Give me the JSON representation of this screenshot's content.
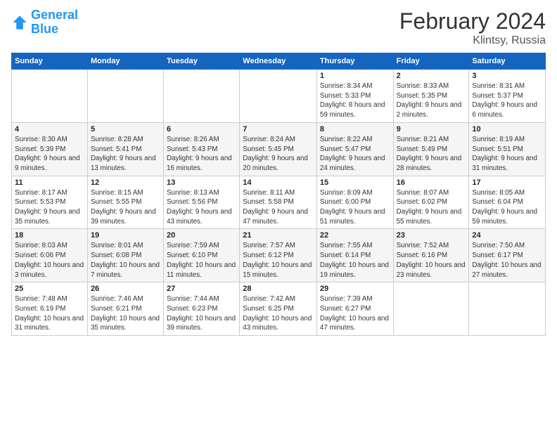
{
  "logo": {
    "line1": "General",
    "line2": "Blue"
  },
  "title": "February 2024",
  "subtitle": "Klintsy, Russia",
  "days_header": [
    "Sunday",
    "Monday",
    "Tuesday",
    "Wednesday",
    "Thursday",
    "Friday",
    "Saturday"
  ],
  "weeks": [
    [
      {
        "day": "",
        "info": ""
      },
      {
        "day": "",
        "info": ""
      },
      {
        "day": "",
        "info": ""
      },
      {
        "day": "",
        "info": ""
      },
      {
        "day": "1",
        "info": "Sunrise: 8:34 AM\nSunset: 5:33 PM\nDaylight: 8 hours and 59 minutes."
      },
      {
        "day": "2",
        "info": "Sunrise: 8:33 AM\nSunset: 5:35 PM\nDaylight: 9 hours and 2 minutes."
      },
      {
        "day": "3",
        "info": "Sunrise: 8:31 AM\nSunset: 5:37 PM\nDaylight: 9 hours and 6 minutes."
      }
    ],
    [
      {
        "day": "4",
        "info": "Sunrise: 8:30 AM\nSunset: 5:39 PM\nDaylight: 9 hours and 9 minutes."
      },
      {
        "day": "5",
        "info": "Sunrise: 8:28 AM\nSunset: 5:41 PM\nDaylight: 9 hours and 13 minutes."
      },
      {
        "day": "6",
        "info": "Sunrise: 8:26 AM\nSunset: 5:43 PM\nDaylight: 9 hours and 16 minutes."
      },
      {
        "day": "7",
        "info": "Sunrise: 8:24 AM\nSunset: 5:45 PM\nDaylight: 9 hours and 20 minutes."
      },
      {
        "day": "8",
        "info": "Sunrise: 8:22 AM\nSunset: 5:47 PM\nDaylight: 9 hours and 24 minutes."
      },
      {
        "day": "9",
        "info": "Sunrise: 8:21 AM\nSunset: 5:49 PM\nDaylight: 9 hours and 28 minutes."
      },
      {
        "day": "10",
        "info": "Sunrise: 8:19 AM\nSunset: 5:51 PM\nDaylight: 9 hours and 31 minutes."
      }
    ],
    [
      {
        "day": "11",
        "info": "Sunrise: 8:17 AM\nSunset: 5:53 PM\nDaylight: 9 hours and 35 minutes."
      },
      {
        "day": "12",
        "info": "Sunrise: 8:15 AM\nSunset: 5:55 PM\nDaylight: 9 hours and 39 minutes."
      },
      {
        "day": "13",
        "info": "Sunrise: 8:13 AM\nSunset: 5:56 PM\nDaylight: 9 hours and 43 minutes."
      },
      {
        "day": "14",
        "info": "Sunrise: 8:11 AM\nSunset: 5:58 PM\nDaylight: 9 hours and 47 minutes."
      },
      {
        "day": "15",
        "info": "Sunrise: 8:09 AM\nSunset: 6:00 PM\nDaylight: 9 hours and 51 minutes."
      },
      {
        "day": "16",
        "info": "Sunrise: 8:07 AM\nSunset: 6:02 PM\nDaylight: 9 hours and 55 minutes."
      },
      {
        "day": "17",
        "info": "Sunrise: 8:05 AM\nSunset: 6:04 PM\nDaylight: 9 hours and 59 minutes."
      }
    ],
    [
      {
        "day": "18",
        "info": "Sunrise: 8:03 AM\nSunset: 6:06 PM\nDaylight: 10 hours and 3 minutes."
      },
      {
        "day": "19",
        "info": "Sunrise: 8:01 AM\nSunset: 6:08 PM\nDaylight: 10 hours and 7 minutes."
      },
      {
        "day": "20",
        "info": "Sunrise: 7:59 AM\nSunset: 6:10 PM\nDaylight: 10 hours and 11 minutes."
      },
      {
        "day": "21",
        "info": "Sunrise: 7:57 AM\nSunset: 6:12 PM\nDaylight: 10 hours and 15 minutes."
      },
      {
        "day": "22",
        "info": "Sunrise: 7:55 AM\nSunset: 6:14 PM\nDaylight: 10 hours and 19 minutes."
      },
      {
        "day": "23",
        "info": "Sunrise: 7:52 AM\nSunset: 6:16 PM\nDaylight: 10 hours and 23 minutes."
      },
      {
        "day": "24",
        "info": "Sunrise: 7:50 AM\nSunset: 6:17 PM\nDaylight: 10 hours and 27 minutes."
      }
    ],
    [
      {
        "day": "25",
        "info": "Sunrise: 7:48 AM\nSunset: 6:19 PM\nDaylight: 10 hours and 31 minutes."
      },
      {
        "day": "26",
        "info": "Sunrise: 7:46 AM\nSunset: 6:21 PM\nDaylight: 10 hours and 35 minutes."
      },
      {
        "day": "27",
        "info": "Sunrise: 7:44 AM\nSunset: 6:23 PM\nDaylight: 10 hours and 39 minutes."
      },
      {
        "day": "28",
        "info": "Sunrise: 7:42 AM\nSunset: 6:25 PM\nDaylight: 10 hours and 43 minutes."
      },
      {
        "day": "29",
        "info": "Sunrise: 7:39 AM\nSunset: 6:27 PM\nDaylight: 10 hours and 47 minutes."
      },
      {
        "day": "",
        "info": ""
      },
      {
        "day": "",
        "info": ""
      }
    ]
  ]
}
